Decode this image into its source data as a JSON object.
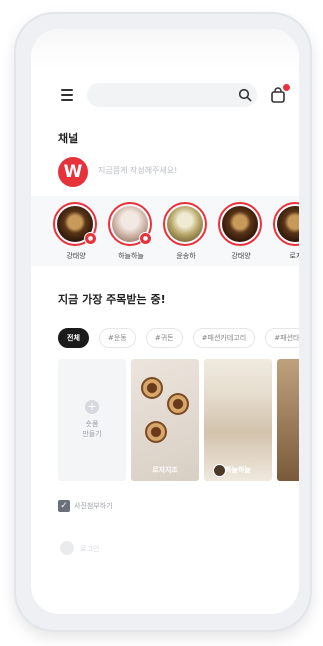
{
  "header": {
    "search_icon": "search-icon",
    "menu_icon": "hamburger-menu-icon",
    "bag_icon": "shopping-bag-icon",
    "accent_color": "#e5323b"
  },
  "channel": {
    "section_title": "채널",
    "logo_letter": "W",
    "post_placeholder": "지금쯤게 작성해주세요!"
  },
  "stories": [
    {
      "name": "강태양",
      "live": true
    },
    {
      "name": "하늘하늘",
      "live": true
    },
    {
      "name": "윤송하",
      "live": false
    },
    {
      "name": "강태양",
      "live": false
    },
    {
      "name": "로지",
      "live": false
    }
  ],
  "trending": {
    "title": "지금 가장 주목받는 중!",
    "chips": [
      "전체",
      "#운동",
      "#귀돈",
      "#패션카테고리",
      "#패션타"
    ],
    "active_chip": "전체"
  },
  "cards": {
    "create_label_1": "숏폼",
    "create_label_2": "만들기",
    "items": [
      {
        "label": "로지지조"
      },
      {
        "label": "하늘하늘"
      }
    ]
  },
  "checkbox": {
    "label": "사진첨부하기",
    "checked": true
  },
  "bottom": {
    "label": "로그인"
  }
}
